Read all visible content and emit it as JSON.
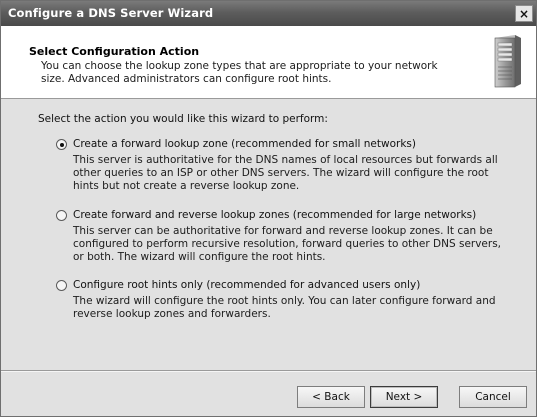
{
  "window": {
    "title": "Configure a DNS Server Wizard",
    "close_glyph": "×"
  },
  "header": {
    "title": "Select Configuration Action",
    "description": "You can choose the lookup zone types that are appropriate to your network size. Advanced administrators can configure root hints.",
    "icon": "server-icon"
  },
  "main": {
    "prompt": "Select the action you would like this wizard to perform:",
    "options": [
      {
        "label": "Create a forward lookup zone (recommended for small networks)",
        "description": "This server is authoritative for the DNS names of local resources but forwards all other queries to an ISP or other DNS servers. The wizard will configure the root hints but not create a reverse lookup zone.",
        "checked": true
      },
      {
        "label": "Create forward and reverse lookup zones (recommended for large networks)",
        "description": "This server can be authoritative for forward and reverse lookup zones. It can be configured to perform recursive resolution, forward queries to other DNS servers, or both. The wizard will configure the root hints.",
        "checked": false
      },
      {
        "label": "Configure root hints only (recommended for advanced users only)",
        "description": "The wizard will configure the root hints only. You can later configure forward and reverse lookup zones and forwarders.",
        "checked": false
      }
    ]
  },
  "footer": {
    "back_label": "< Back",
    "next_label": "Next >",
    "cancel_label": "Cancel"
  }
}
